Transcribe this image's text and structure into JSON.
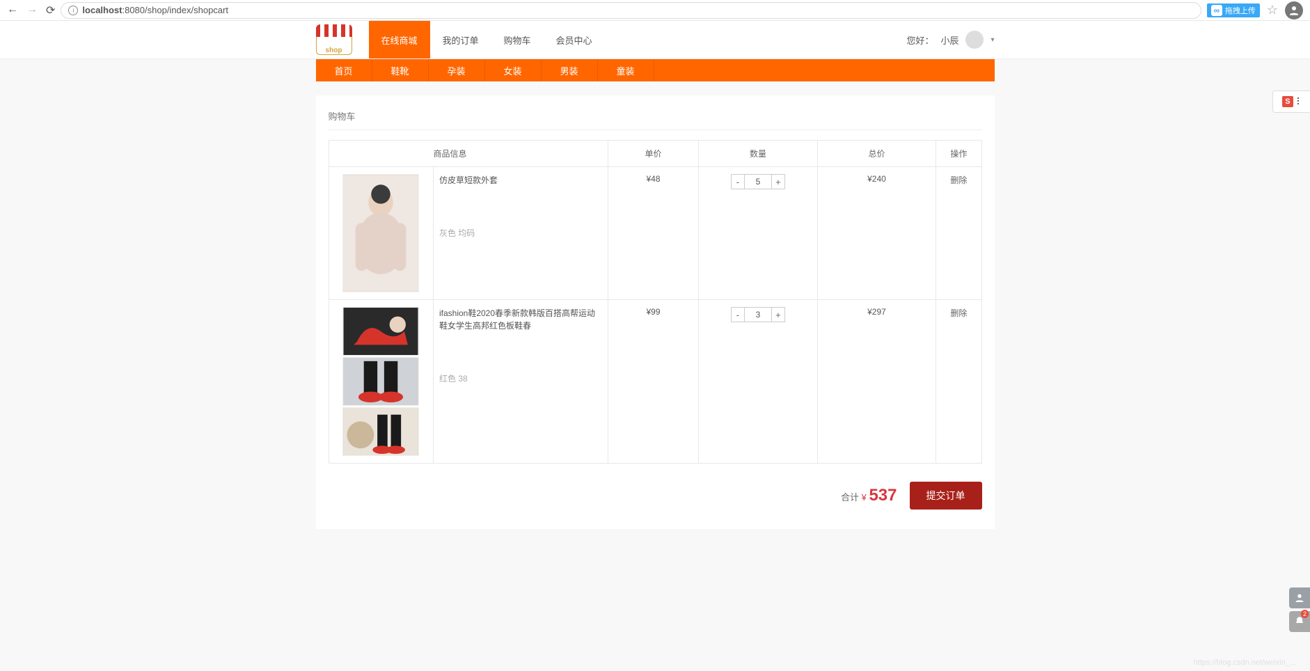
{
  "browser": {
    "url_host": "localhost",
    "url_path": ":8080/shop/index/shopcart",
    "ext_label": "拖拽上传",
    "ext_icon_letter": "∞"
  },
  "nav": {
    "items": [
      "在线商城",
      "我的订单",
      "购物车",
      "会员中心"
    ],
    "activeIndex": 0,
    "greeting": "您好：",
    "username": "小辰"
  },
  "categories": [
    "首页",
    "鞋靴",
    "孕装",
    "女装",
    "男装",
    "童装"
  ],
  "cart": {
    "title": "购物车",
    "headers": {
      "info": "商品信息",
      "price": "单价",
      "qty": "数量",
      "total": "总价",
      "op": "操作"
    },
    "items": [
      {
        "title": "仿皮草短款外套",
        "spec": "灰色 均码",
        "price": "¥48",
        "qty": "5",
        "total": "¥240",
        "delete": "删除",
        "image_kind": "coat"
      },
      {
        "title": "ifashion鞋2020春季新款韩版百搭高帮运动鞋女学生高邦红色板鞋春",
        "spec": "红色 38",
        "price": "¥99",
        "qty": "3",
        "total": "¥297",
        "delete": "删除",
        "image_kind": "shoes"
      }
    ],
    "footer": {
      "label": "合计",
      "currency": "¥",
      "value": "537",
      "submit": "提交订单"
    },
    "qty_minus": "-",
    "qty_plus": "+"
  },
  "float": {
    "s_letter": "S"
  },
  "side_badge": "2",
  "watermark": "https://blog.csdn.net/weixin_..."
}
